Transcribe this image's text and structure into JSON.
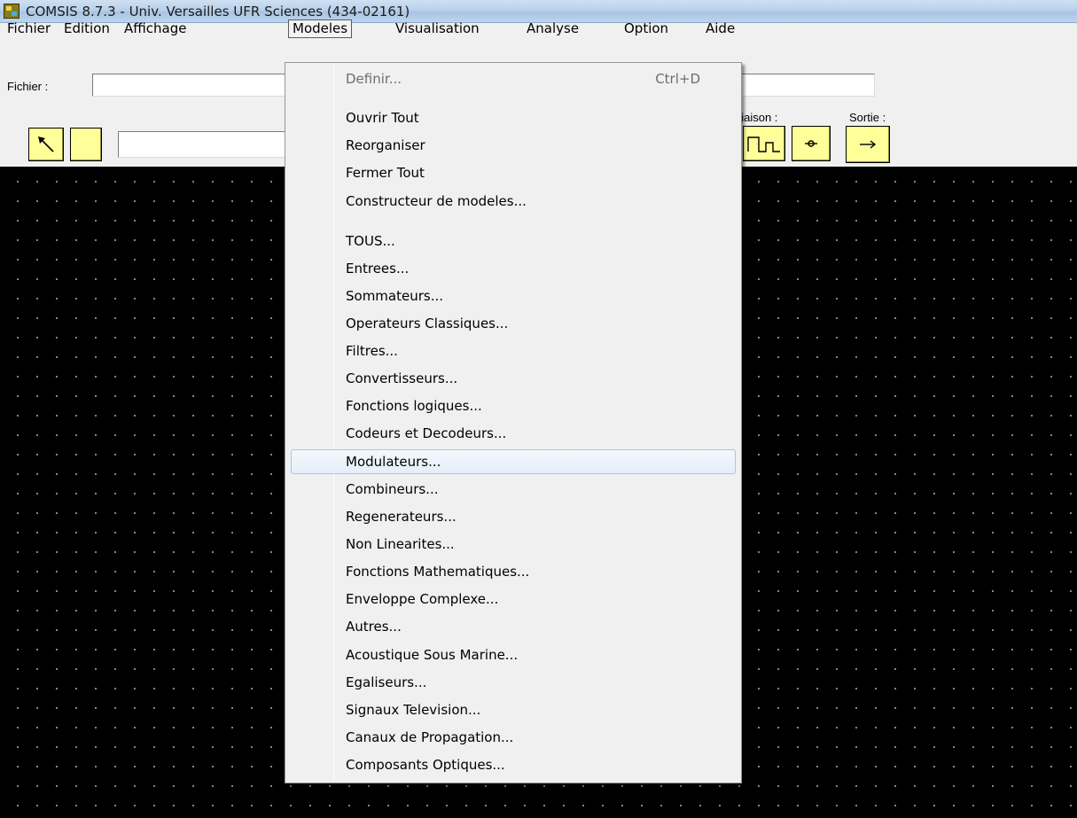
{
  "window": {
    "title": "COMSIS 8.7.3 - Univ. Versailles UFR Sciences (434-02161)",
    "app_icon": "comsis-app-icon"
  },
  "menubar": {
    "items": [
      "Fichier",
      "Edition",
      "Affichage",
      "Modeles",
      "Visualisation",
      "Analyse",
      "Option",
      "Aide"
    ],
    "open_menu": "Modeles"
  },
  "toolbar": {
    "file_label": "Fichier :",
    "file_value": "",
    "link_label": "Liaison :",
    "output_label": "Sortie :",
    "name_value": "",
    "right_field_value": "",
    "icons": {
      "select": "arrow-pointer-icon",
      "pulse": "pulse-connector-icon",
      "node": "node-junction-icon",
      "output": "arrow-right-icon"
    }
  },
  "dropdown": {
    "items": [
      {
        "label": "Definir...",
        "shortcut": "Ctrl+D",
        "disabled": true
      },
      {
        "label": "Ouvrir Tout"
      },
      {
        "label": "Reorganiser"
      },
      {
        "label": "Fermer Tout"
      },
      {
        "label": "Constructeur de modeles..."
      },
      {
        "label": "TOUS..."
      },
      {
        "label": "Entrees..."
      },
      {
        "label": "Sommateurs..."
      },
      {
        "label": "Operateurs Classiques..."
      },
      {
        "label": "Filtres..."
      },
      {
        "label": "Convertisseurs..."
      },
      {
        "label": "Fonctions logiques..."
      },
      {
        "label": "Codeurs et Decodeurs..."
      },
      {
        "label": "Modulateurs...",
        "highlighted": true
      },
      {
        "label": "Combineurs..."
      },
      {
        "label": "Regenerateurs..."
      },
      {
        "label": "Non Linearites..."
      },
      {
        "label": "Fonctions Mathematiques..."
      },
      {
        "label": "Enveloppe Complexe..."
      },
      {
        "label": "Autres..."
      },
      {
        "label": "Acoustique Sous Marine..."
      },
      {
        "label": "Egaliseurs..."
      },
      {
        "label": "Signaux Television..."
      },
      {
        "label": "Canaux de Propagation..."
      },
      {
        "label": "Composants Optiques..."
      }
    ]
  },
  "colors": {
    "canvas": "#000000",
    "grid_dot": "#9a9a9a",
    "tool_button": "#ffff99",
    "menu_bg": "#f0f0f0",
    "highlight_border": "#a8c6ea"
  }
}
